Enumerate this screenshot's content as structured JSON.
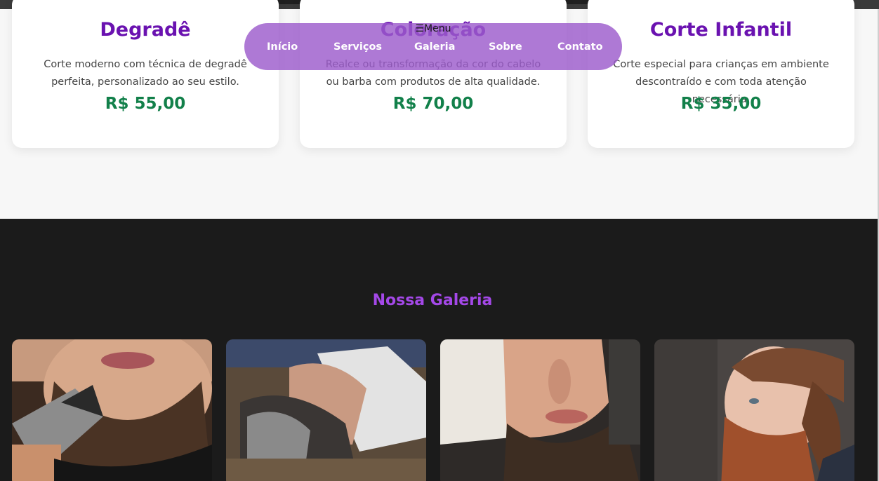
{
  "nav": {
    "menu_label": "☰Menu",
    "links": [
      "Início",
      "Serviços",
      "Galeria",
      "Sobre",
      "Contato"
    ]
  },
  "services": [
    {
      "title": "Degradê",
      "description": "Corte moderno com técnica de degradê perfeita, personalizado ao seu estilo.",
      "price": "R$ 55,00"
    },
    {
      "title": "Coloração",
      "description": "Realce ou transformação da cor do cabelo ou barba com produtos de alta qualidade.",
      "price": "R$ 70,00"
    },
    {
      "title": "Corte Infantil",
      "description": "Corte especial para crianças em ambiente descontraído e com toda atenção necessária.",
      "price": "R$ 35,00"
    }
  ],
  "gallery": {
    "title": "Nossa Galeria",
    "photos": [
      {
        "icon": "beard-trim-photo"
      },
      {
        "icon": "hot-towel-shave-photo"
      },
      {
        "icon": "beard-profile-towel-photo"
      },
      {
        "icon": "red-beard-man-photo"
      }
    ]
  },
  "colors": {
    "accent_purple": "#6a12b0",
    "price_green": "#12804a",
    "nav_background": "#9c5ccc",
    "gallery_background": "#1b1b1b",
    "gallery_title": "#a448e8"
  }
}
